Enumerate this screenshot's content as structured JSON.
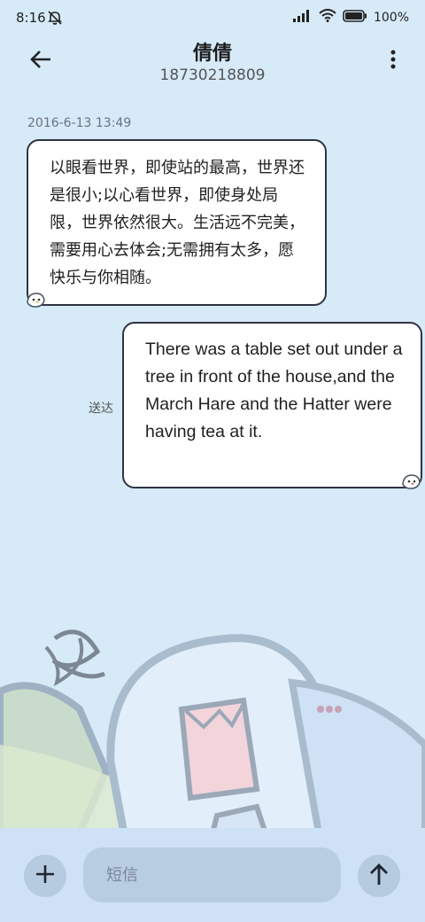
{
  "status_bar": {
    "time": "8:16",
    "battery": "100%"
  },
  "header": {
    "contact_name": "倩倩",
    "phone_number": "18730218809"
  },
  "messages": [
    {
      "direction": "incoming",
      "timestamp": "2016-6-13 13:49",
      "text": "以眼看世界，即使站的最高，世界还是很小;以心看世界，即使身处局限，世界依然很大。生活远不完美，需要用心去体会;无需拥有太多，愿快乐与你相随。"
    },
    {
      "direction": "outgoing",
      "status": "送达",
      "text": "There was a table set out under a tree in front of the house,and the March Hare and the Hatter were having tea at it."
    }
  ],
  "composer": {
    "placeholder": "短信"
  },
  "icons": {
    "back": "arrow-left-icon",
    "more": "more-vertical-icon",
    "add": "plus-icon",
    "send": "arrow-up-icon",
    "mute": "bell-off-icon",
    "signal": "signal-icon",
    "wifi": "wifi-icon",
    "battery": "battery-icon"
  },
  "colors": {
    "background": "#d6eaf8",
    "bubble": "#ffffff",
    "bubble_border": "#2f3440",
    "bottom_bar": "#cfe2f5"
  }
}
